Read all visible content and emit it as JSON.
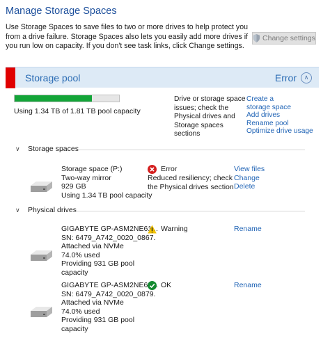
{
  "page": {
    "title": "Manage Storage Spaces",
    "intro": "Use Storage Spaces to save files to two or more drives to help protect you from a drive failure. Storage Spaces also lets you easily add more drives if you run low on capacity. If you don't see task links, click Change settings.",
    "change_settings_label": "Change settings"
  },
  "pool": {
    "name": "Storage pool",
    "status": "Error",
    "usage_text": "Using 1.34 TB of 1.81 TB pool capacity",
    "usage_fraction": 0.74,
    "note": "Drive or storage space issues; check the Physical drives and Storage spaces sections",
    "links": [
      "Create a storage space",
      "Add drives",
      "Rename pool",
      "Optimize drive usage"
    ]
  },
  "storage_spaces": {
    "heading": "Storage spaces",
    "items": [
      {
        "lines": [
          "Storage space (P:)",
          "Two-way mirror",
          "929 GB",
          "Using 1.34 TB pool capacity"
        ],
        "status_label": "Error",
        "status_detail": "Reduced resiliency; check the Physical drives section",
        "links": [
          "View files",
          "Change",
          "Delete"
        ]
      }
    ]
  },
  "physical_drives": {
    "heading": "Physical drives",
    "items": [
      {
        "lines": [
          "GIGABYTE GP-ASM2NE61...",
          "SN: 6479_A742_0020_0867.",
          "Attached via NVMe",
          "74.0% used",
          "Providing 931 GB pool",
          "capacity"
        ],
        "status_label": "Warning",
        "link": "Rename"
      },
      {
        "lines": [
          "GIGABYTE GP-ASM2NE61...",
          "SN: 6479_A742_0020_0879.",
          "Attached via NVMe",
          "74.0% used",
          "Providing 931 GB pool",
          "capacity"
        ],
        "status_label": "OK",
        "link": "Rename"
      }
    ]
  },
  "icons": {
    "shield": "shield-icon",
    "collapse": "chevron-up-icon",
    "drive": "drive-icon",
    "error": "error-icon",
    "warning": "warning-icon",
    "ok": "ok-icon"
  },
  "colors": {
    "title": "#1c4f9c",
    "link": "#1f63b5",
    "error_red": "#e00000",
    "progress_green": "#13a538",
    "header_bg": "#ddeaf6"
  }
}
